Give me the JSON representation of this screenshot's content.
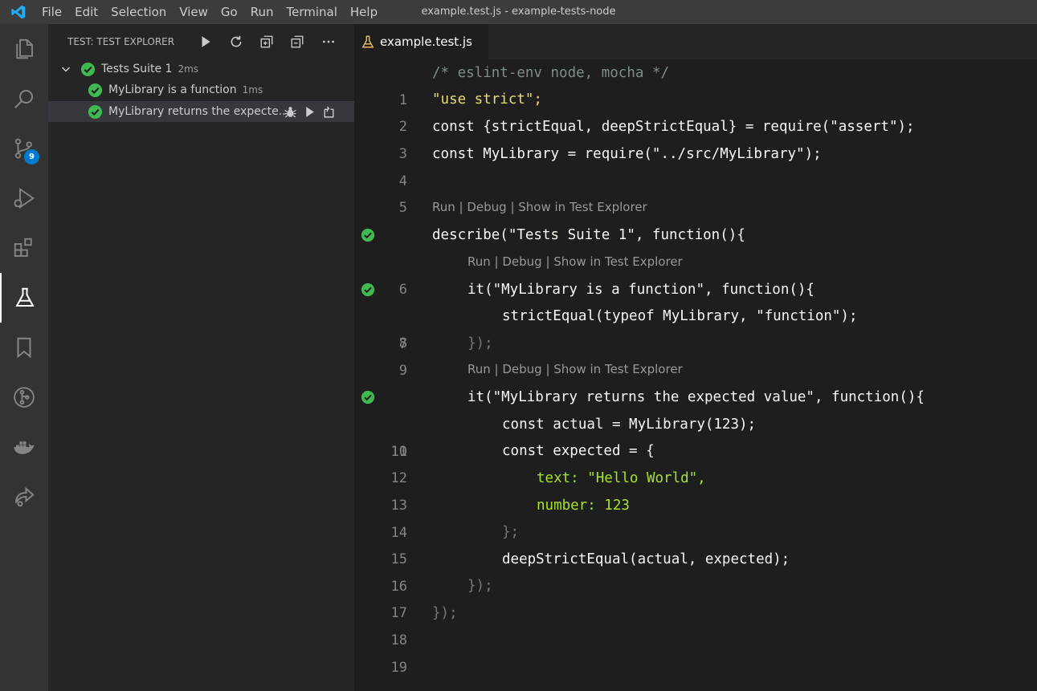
{
  "window": {
    "title": "example.test.js - example-tests-node"
  },
  "menu": [
    "File",
    "Edit",
    "Selection",
    "View",
    "Go",
    "Run",
    "Terminal",
    "Help"
  ],
  "activity_bar": {
    "items": [
      "explorer-icon",
      "search-icon",
      "source-control-icon",
      "run-debug-icon",
      "extensions-icon",
      "test-explorer-icon",
      "bookmarks-icon",
      "git-graph-icon",
      "docker-icon",
      "live-share-icon"
    ],
    "active": "test-explorer-icon",
    "scm_badge": "9"
  },
  "sidebar": {
    "title": "TEST: TEST EXPLORER",
    "actions": [
      "run-all-icon",
      "refresh-icon",
      "expand-all-icon",
      "collapse-all-icon",
      "more-actions-icon"
    ],
    "tree": [
      {
        "label": "Tests Suite 1",
        "time": "2ms",
        "status": "passed",
        "level": 0,
        "expanded": true
      },
      {
        "label": "MyLibrary is a function",
        "time": "1ms",
        "status": "passed",
        "level": 1
      },
      {
        "label": "MyLibrary returns the expecte...",
        "time": "",
        "status": "passed",
        "level": 1,
        "selected": true
      }
    ]
  },
  "editor": {
    "tab": {
      "label": "example.test.js",
      "icon": "flask-icon"
    },
    "codelens": "Run | Debug | Show in Test Explorer",
    "line_numbers": [
      "1",
      "2",
      "3",
      "4",
      "5",
      "6",
      "7",
      "8",
      "9",
      "10",
      "11",
      "12",
      "13",
      "14",
      "15",
      "16",
      "17",
      "18",
      "19"
    ],
    "lines": [
      "/* eslint-env node, mocha */",
      "\"use strict\";",
      "const {strictEqual, deepStrictEqual} = require(\"assert\");",
      "const MyLibrary = require(\"../src/MyLibrary\");",
      "",
      "describe(\"Tests Suite 1\", function(){",
      "it(\"MyLibrary is a function\", function(){",
      "strictEqual(typeof MyLibrary, \"function\");",
      "});",
      "it(\"MyLibrary returns the expected value\", function(){",
      "const actual = MyLibrary(123);",
      "const expected = {",
      "text: \"Hello World\",",
      "number: 123",
      "};",
      "deepStrictEqual(actual, expected);",
      "});",
      "});",
      ""
    ]
  },
  "colors": {
    "pass_green": "#3fb950",
    "accent_blue": "#007acc",
    "keyword": "#f92672",
    "string": "#e6db74",
    "number": "#66d9ef",
    "property": "#a6e22e"
  }
}
